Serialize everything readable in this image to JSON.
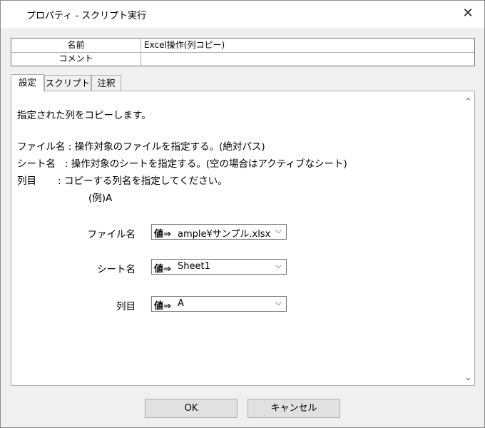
{
  "window": {
    "title": "プロパティ - スクリプト実行",
    "close_glyph": "✕"
  },
  "properties": [
    {
      "name": "名前",
      "value": "Excel操作(列コピー)"
    },
    {
      "name": "コメント",
      "value": ""
    }
  ],
  "tabs": [
    {
      "label": "設定"
    },
    {
      "label": "スクリプト"
    },
    {
      "label": "注釈"
    }
  ],
  "description": {
    "intro": "指定された列をコピーします。",
    "file_line": "ファイル名 : 操作対象のファイルを指定する。(絶対パス)",
    "sheet_line": "シート名   : 操作対象のシートを指定する。(空の場合はアクティブなシート)",
    "column_line": "列目       : コピーする列名を指定してください。",
    "example_line": "(例)A"
  },
  "fields": {
    "file": {
      "label": "ファイル名",
      "prefix": "値⇒",
      "value": "ample¥サンプル.xlsx"
    },
    "sheet": {
      "label": "シート名",
      "prefix": "値⇒",
      "value": "Sheet1"
    },
    "column": {
      "label": "列目",
      "prefix": "値⇒",
      "value": "A"
    }
  },
  "buttons": {
    "ok": "OK",
    "cancel": "キャンセル"
  },
  "icons": {
    "chevron": "chevron-down-icon",
    "scroll_up": "scroll-up-icon",
    "scroll_down": "scroll-down-icon"
  }
}
